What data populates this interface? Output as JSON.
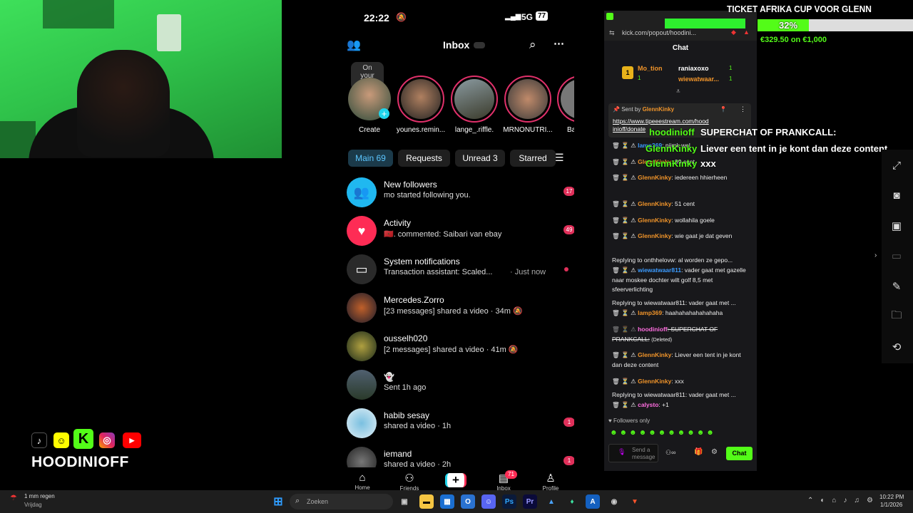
{
  "phone": {
    "status_time": "22:22",
    "status_network": "5G",
    "status_battery": "77",
    "header_title": "Inbox",
    "stories": [
      {
        "label": "Create",
        "bubble": "On your mind..."
      },
      {
        "label": "younes.remin..."
      },
      {
        "label": "lange_.riffle."
      },
      {
        "label": "MRNONUTRI..."
      },
      {
        "label": "Ba"
      }
    ],
    "filters": [
      "Main 69",
      "Requests",
      "Unread 3",
      "Starred"
    ],
    "rows": [
      {
        "name": "New followers",
        "sub": "mo started following you.",
        "badge": "17"
      },
      {
        "name": "Activity",
        "sub": "🇲🇦. commented: Saibari van ebay",
        "badge": "49"
      },
      {
        "name": "System notifications",
        "sub": "Transaction assistant: Scaled...",
        "time": "· Just now"
      },
      {
        "name": "Mercedes.Zorro",
        "sub": "[23 messages] shared a video · 34m 🔕"
      },
      {
        "name": "ousselh020",
        "sub": "[2 messages] shared a video · 41m 🔕"
      },
      {
        "name": "👻",
        "sub": "Sent 1h ago"
      },
      {
        "name": "habib sesay",
        "sub": "shared a video · 1h",
        "badge": "1"
      },
      {
        "name": "iemand",
        "sub": "shared a video · 2h",
        "badge": "1"
      }
    ],
    "nav": {
      "home": "Home",
      "friends": "Friends",
      "inbox": "Inbox",
      "inbox_badge": "71",
      "profile": "Profile"
    }
  },
  "chat": {
    "url": "kick.com/popout/hoodini...",
    "title": "Chat",
    "leaderboard": [
      {
        "rank": "1",
        "name": "Mo_tion",
        "count": "1"
      },
      {
        "name": "raniaxoxo",
        "count": "1"
      },
      {
        "name": "wiewatwaar...",
        "count": "1"
      }
    ],
    "pinned_sender": "Sent by",
    "pinned_user": "GlennKinky",
    "pinned_link": "https://www.tipeeestream.com/hood inioff/donate",
    "messages": [
      {
        "user": "lamp369",
        "text": ": nijmk wel"
      },
      {
        "user": "GlennKinky",
        "text": ": 99 cent"
      },
      {
        "user": "GlennKinky",
        "text": ": iedereen hhierheen"
      },
      {
        "user": "GlennKinky",
        "text": ": 51 cent"
      },
      {
        "user": "GlennKinky",
        "text": ": wollahila goele"
      },
      {
        "user": "GlennKinky",
        "text": ": wie gaat je dat geven"
      },
      {
        "reply": "Replying to onthhelovw: al worden ze gepo..."
      },
      {
        "user": "wiewatwaar811",
        "text": ": vader gaat met gazelle naar moskee dochter wilt golf 8,5 met sfeerverlichting"
      },
      {
        "reply": "Replying to wiewatwaar811: vader gaat met ..."
      },
      {
        "user": "lamp369",
        "text": ": haahahahahahahaha"
      },
      {
        "user": "hoodinioff",
        "text": ": SUPERCHAT OF PRANKCALL:",
        "deleted": "(Deleted)"
      },
      {
        "user": "GlennKinky",
        "text": ": Liever een tent in je kont dan deze content"
      },
      {
        "user": "GlennKinky",
        "text": ": xxx"
      },
      {
        "reply": "Replying to wiewatwaar811: vader gaat met ..."
      },
      {
        "user": "calysto",
        "text": ": +1"
      }
    ],
    "followers_only": "Followers only",
    "input_placeholder": "Send a message",
    "send_label": "Chat"
  },
  "overlay": {
    "goal_title": "TICKET AFRIKA CUP VOOR GLENN",
    "goal_percent": "32%",
    "goal_amount": "€329.50 on €1,000",
    "goal_fraction": 0.3295,
    "superchat_user": "hoodinioff",
    "superchat_text": "SUPERCHAT OF PRANKCALL:",
    "tts_user": "GlennKinky",
    "tts_text": "Liever een tent in je kont dan deze content",
    "tts_user2": "GlennKinky",
    "tts_text2": "xxx"
  },
  "brand": {
    "name": "HOODINIOFF"
  },
  "taskbar": {
    "weather_temp": "1 mm regen",
    "weather_day": "Vrijdag",
    "search_placeholder": "Zoeken",
    "time": "10:22 PM",
    "date": "1/1/2026"
  },
  "colors": {
    "accent_green": "#53fc18",
    "tiktok_pink": "#e0305a",
    "chat_bg": "#18181b",
    "glenn_orange": "#f0942a"
  }
}
